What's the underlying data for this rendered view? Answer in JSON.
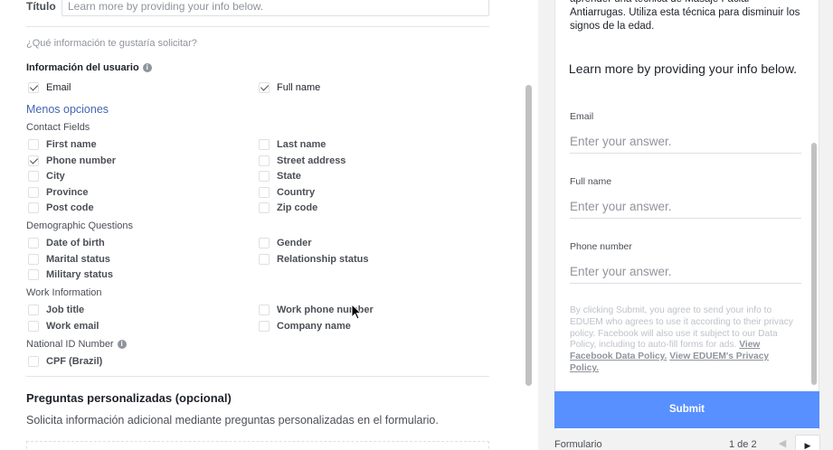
{
  "titulo": {
    "label": "Título",
    "placeholder": "Learn more by providing your info below."
  },
  "question": "¿Qué información te gustaría solicitar?",
  "user_info": {
    "label": "Información del usuario",
    "email": "Email",
    "full_name": "Full name"
  },
  "menos_opciones": "Menos opciones",
  "contact_fields": {
    "label": "Contact Fields",
    "first_name": "First name",
    "last_name": "Last name",
    "phone_number": "Phone number",
    "street_address": "Street address",
    "city": "City",
    "state": "State",
    "province": "Province",
    "country": "Country",
    "post_code": "Post code",
    "zip_code": "Zip code"
  },
  "demographic": {
    "label": "Demographic Questions",
    "date_of_birth": "Date of birth",
    "gender": "Gender",
    "marital_status": "Marital status",
    "relationship_status": "Relationship status",
    "military_status": "Military status"
  },
  "work": {
    "label": "Work Information",
    "job_title": "Job title",
    "work_phone_number": "Work phone number",
    "work_email": "Work email",
    "company_name": "Company name"
  },
  "national_id": {
    "label": "National ID Number",
    "cpf": "CPF (Brazil)"
  },
  "custom_questions": {
    "title": "Preguntas personalizadas (opcional)",
    "description": "Solicita información adicional mediante preguntas personalizadas en el formulario."
  },
  "preview": {
    "intro": "aprender una técnica de Masaje Facial Antiarrugas. Utiliza esta técnica para disminuir los signos de la edad.",
    "heading": "Learn more by providing your info below.",
    "fields": [
      {
        "label": "Email",
        "placeholder": "Enter your answer."
      },
      {
        "label": "Full name",
        "placeholder": "Enter your answer."
      },
      {
        "label": "Phone number",
        "placeholder": "Enter your answer."
      }
    ],
    "disclaimer": "By clicking Submit, you agree to send your info to EDUEM who agrees to use it according to their privacy policy. Facebook will also use it subject to our Data Policy, including to auto-fill forms for ads.",
    "link_fb_policy": "View Facebook Data Policy.",
    "link_eduem_policy": "View EDUEM's Privacy Policy.",
    "submit": "Submit"
  },
  "footer": {
    "label": "Formulario",
    "pager": "1 de 2"
  },
  "colors": {
    "accent_link": "#4267b2",
    "submit_bg": "#5890ff"
  },
  "icons": {
    "info": "info-icon",
    "checkbox_checked": "check-icon",
    "prev": "chevron-left-icon",
    "next": "chevron-right-icon"
  }
}
